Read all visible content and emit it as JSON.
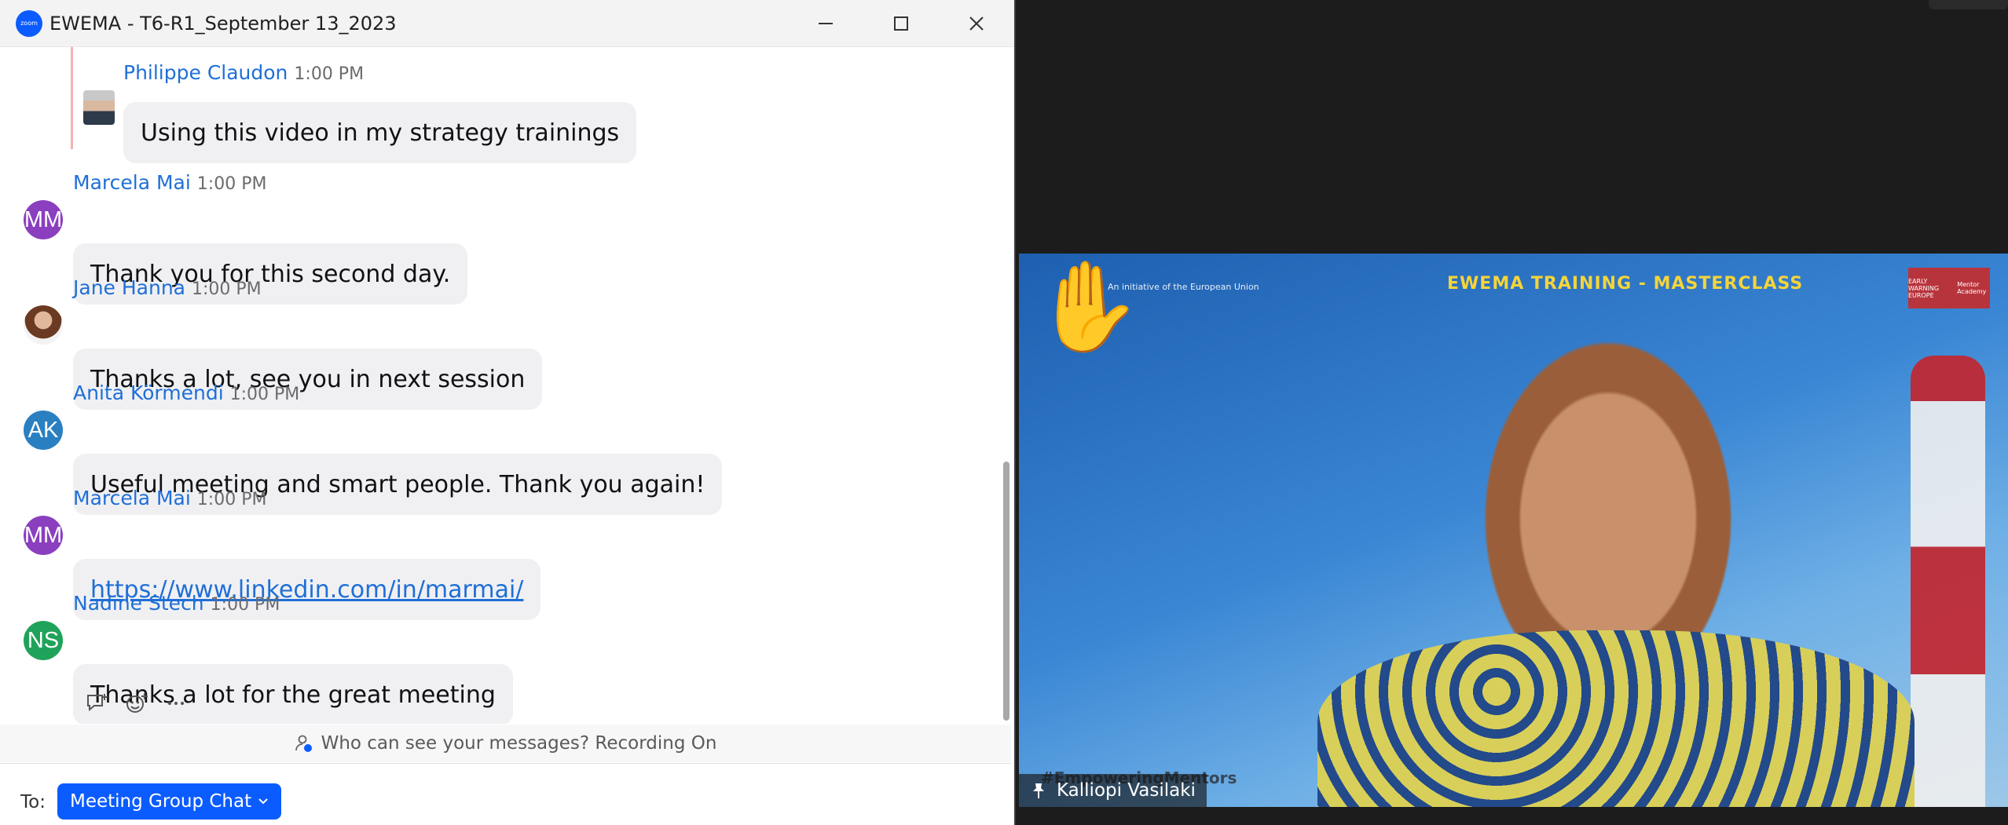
{
  "window": {
    "app_icon_text": "zoom",
    "title": "EWEMA - T6-R1_September 13_2023",
    "controls": [
      "minimize-icon",
      "maximize-icon",
      "close-icon"
    ]
  },
  "messages": [
    {
      "sender": "Philippe Claudon",
      "time": "1:00 PM",
      "text": "Using this video in my strategy trainings",
      "avatar": {
        "type": "photo"
      },
      "quoted": true
    },
    {
      "sender": "Marcela Mai",
      "time": "1:00 PM",
      "text": "Thank you for this second day.",
      "avatar": {
        "initials": "MM",
        "color": "#8a3fbf"
      }
    },
    {
      "sender": "Jane Hanna",
      "time": "1:00 PM",
      "text": "Thanks a lot, see you in next session",
      "avatar": {
        "type": "photo"
      }
    },
    {
      "sender": "Anita Körmendi",
      "time": "1:00 PM",
      "text": "Useful meeting and smart people. Thank you again!",
      "avatar": {
        "initials": "AK",
        "color": "#2a7fc1"
      }
    },
    {
      "sender": "Marcela Mai",
      "time": "1:00 PM",
      "link": "https://www.linkedin.com/in/marmai/",
      "avatar": {
        "initials": "MM",
        "color": "#8a3fbf"
      }
    },
    {
      "sender": "Nadine Stech",
      "time": "1:00 PM",
      "text": "Thanks a lot for the great meeting",
      "avatar": {
        "initials": "NS",
        "color": "#1fa35a"
      }
    }
  ],
  "message_actions": [
    "reply-icon",
    "emoji-reaction-icon",
    "more-icon"
  ],
  "notice": "Who can see your messages? Recording On",
  "composer": {
    "to_label": "To:",
    "recipient": "Meeting Group Chat"
  },
  "video": {
    "banner_left": "An initiative of the European Union",
    "banner_title": "EWEMA TRAINING - MASTERCLASS",
    "logo_left": "EARLY WARNING EUROPE",
    "logo_right": "Mentor Academy",
    "background_tag": "#EmpoweringMentors",
    "participant_name": "Kalliopi Vasilaki",
    "raised_hand": "✋"
  },
  "colors": {
    "accent": "#0b5cff",
    "link": "#1f6fd6",
    "bubble": "#f0f0f3"
  }
}
